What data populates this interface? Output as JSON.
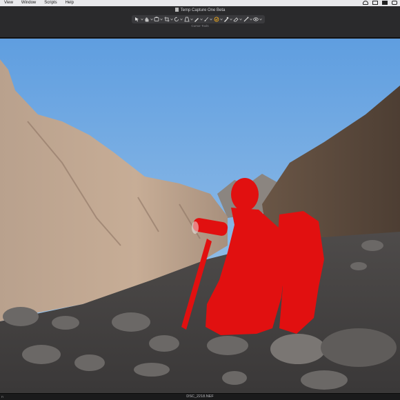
{
  "menubar": {
    "items": [
      "View",
      "Window",
      "Scripts",
      "Help"
    ],
    "status_icons": [
      "wifi-icon",
      "screen-mirror-icon",
      "display-icon",
      "control-center-icon"
    ]
  },
  "window": {
    "title": "Temp Capture One Beta"
  },
  "toolbar": {
    "tools_label": "Cursor Tools",
    "tools": [
      "select-tool-icon",
      "pan-tool-icon",
      "loupe-tool-icon",
      "crop-tool-icon",
      "rotate-tool-icon",
      "keystone-tool-icon",
      "spot-removal-tool-icon",
      "brush-tool-icon",
      "ai-select-tool-icon",
      "picker-tool-icon",
      "eraser-tool-icon",
      "gradient-tool-icon",
      "mask-overlay-tool-icon"
    ],
    "active_tool": "ai-select-tool-icon"
  },
  "viewer": {
    "image": "mountain-canyon-photo",
    "mask_color": "#ff0000"
  },
  "statusbar": {
    "left_text": "n",
    "filename": "DSC_2218.NEF"
  },
  "colors": {
    "sky": "#6fa8e0",
    "rock_light": "#b9a08c",
    "rock_dark": "#5a4a3e",
    "ground": "#4a4a4c",
    "mask": "#e11010",
    "accent_tool": "#e0a020"
  }
}
